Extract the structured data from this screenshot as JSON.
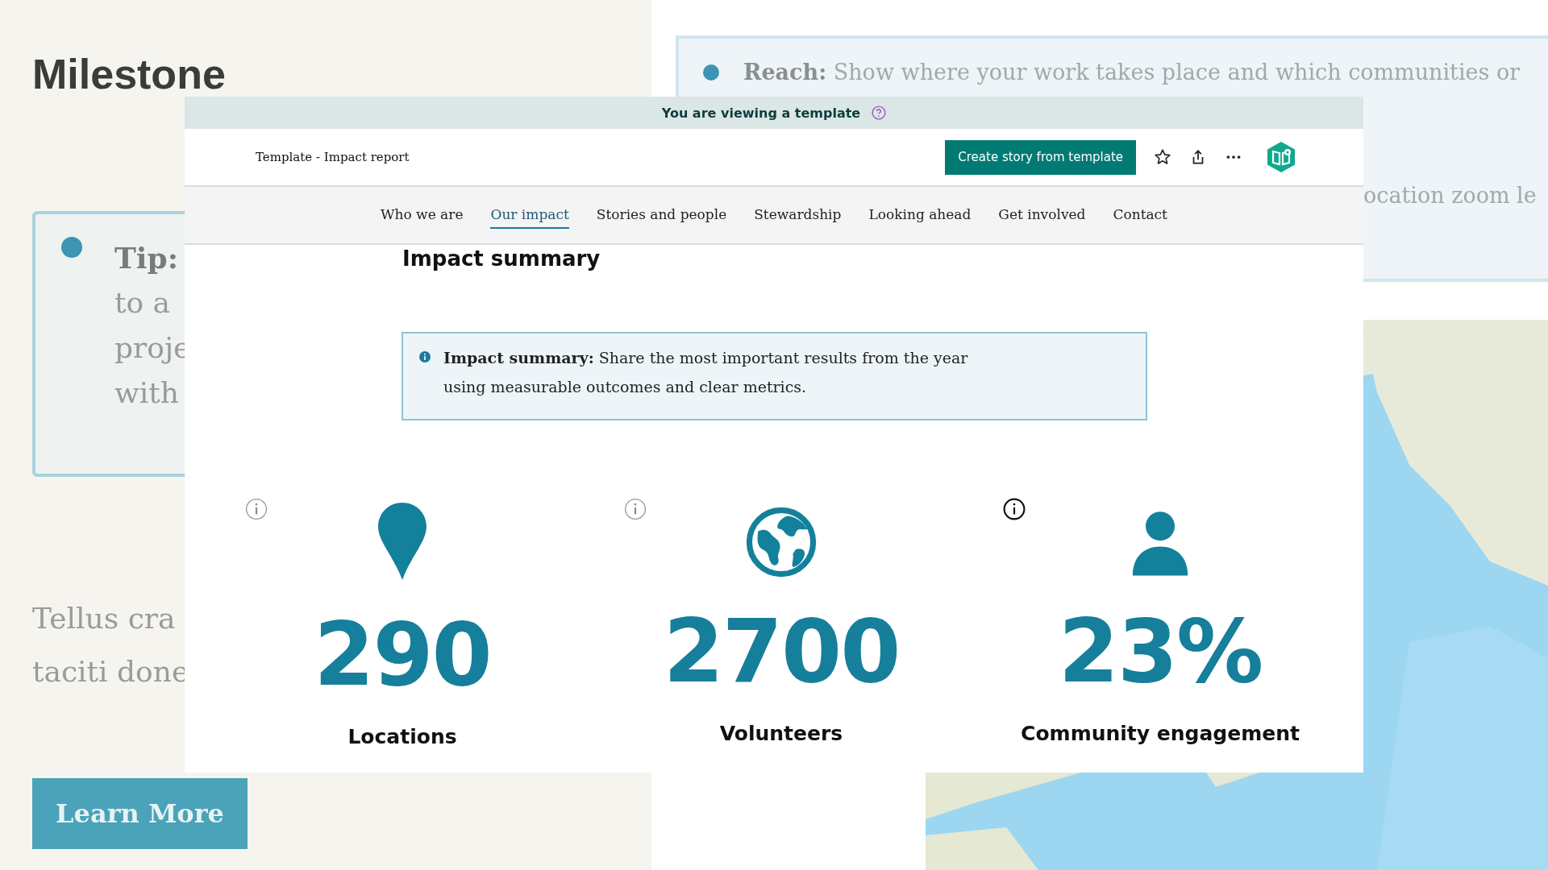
{
  "background": {
    "left_panel": {
      "heading": "Milestone",
      "tip": {
        "label": "Tip:",
        "lines": [
          "to a",
          "proje",
          "with"
        ]
      },
      "paragraph_lines": [
        "Tellus cra",
        "taciti done"
      ],
      "button": "Learn More"
    },
    "right_panel": {
      "callout": {
        "label": "Reach:",
        "text": "Show where your work takes place and which communities or",
        "line_2": "ocation zoom le"
      }
    }
  },
  "banner": {
    "text": "You are viewing a template"
  },
  "header": {
    "title": "Template - Impact report",
    "button": "Create story from template"
  },
  "nav": [
    {
      "label": "Who we are",
      "selected": false
    },
    {
      "label": "Our impact",
      "selected": true
    },
    {
      "label": "Stories and people",
      "selected": false
    },
    {
      "label": "Stewardship",
      "selected": false
    },
    {
      "label": "Looking ahead",
      "selected": false
    },
    {
      "label": "Get involved",
      "selected": false
    },
    {
      "label": "Contact",
      "selected": false
    }
  ],
  "section": {
    "heading": "Impact summary",
    "callout": "**Impact summary:** Share the most important results from the year using measurable outcomes and clear metrics."
  },
  "stats": [
    {
      "kind": "pin",
      "value": "290",
      "label": "Locations",
      "selected": false
    },
    {
      "kind": "globe",
      "value": "2700",
      "label": "Volunteers",
      "selected": false
    },
    {
      "kind": "person",
      "value": "23%",
      "label": "Community engagement",
      "selected": true
    }
  ]
}
